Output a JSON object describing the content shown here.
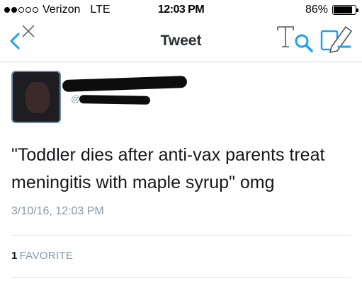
{
  "status_bar": {
    "carrier": "Verizon",
    "network": "LTE",
    "time": "12:03 PM",
    "battery_percent": "86%",
    "battery_level": 0.86,
    "signal_bars": 2,
    "signal_total": 5
  },
  "nav": {
    "title": "Tweet",
    "accent_color": "#1da1f2"
  },
  "tweet": {
    "handle_prefix": "@",
    "text": "\"Toddler dies after anti-vax parents treat meningitis with maple syrup\" omg",
    "timestamp": "3/10/16, 12:03 PM",
    "favorites_count": "1",
    "favorites_label": "FAVORITE"
  },
  "icons": {
    "back": "chevron-left-icon",
    "close": "close-icon",
    "font": "font-size-icon",
    "search": "search-icon",
    "compose": "compose-icon"
  }
}
